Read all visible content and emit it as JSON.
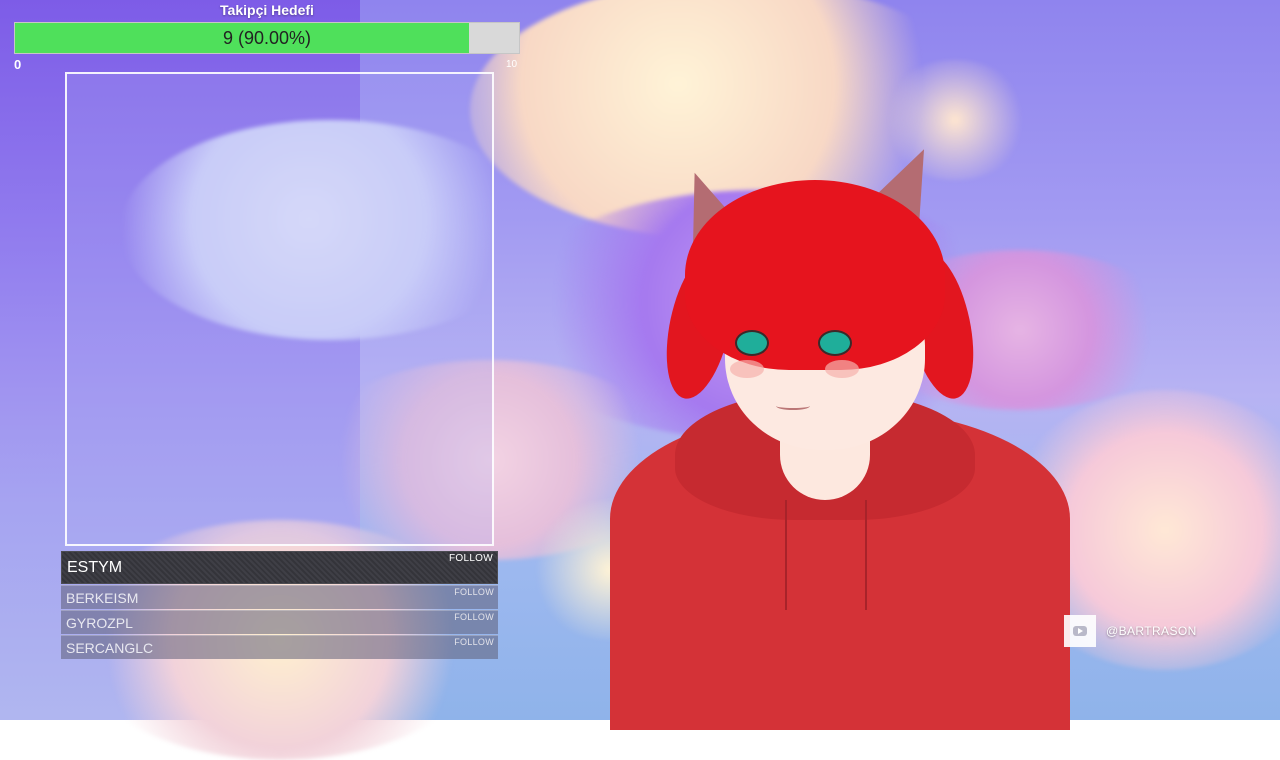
{
  "goal": {
    "title": "Takipçi Hedefi",
    "progress_text": "9 (90.00%)",
    "fraction": 0.9,
    "min_label": "0",
    "max_label": "10",
    "fill_color": "#4fe05b"
  },
  "followers": {
    "top": {
      "name": "ESTYM",
      "tag": "FOLLOW"
    },
    "items": [
      {
        "name": "BERKEISM",
        "tag": "FOLLOW"
      },
      {
        "name": "GYROZPL",
        "tag": "FOLLOW"
      },
      {
        "name": "SERCANGLC",
        "tag": "FOLLOW"
      }
    ]
  },
  "social": {
    "icon": "youtube-icon",
    "handle": "@BARTRASON"
  }
}
